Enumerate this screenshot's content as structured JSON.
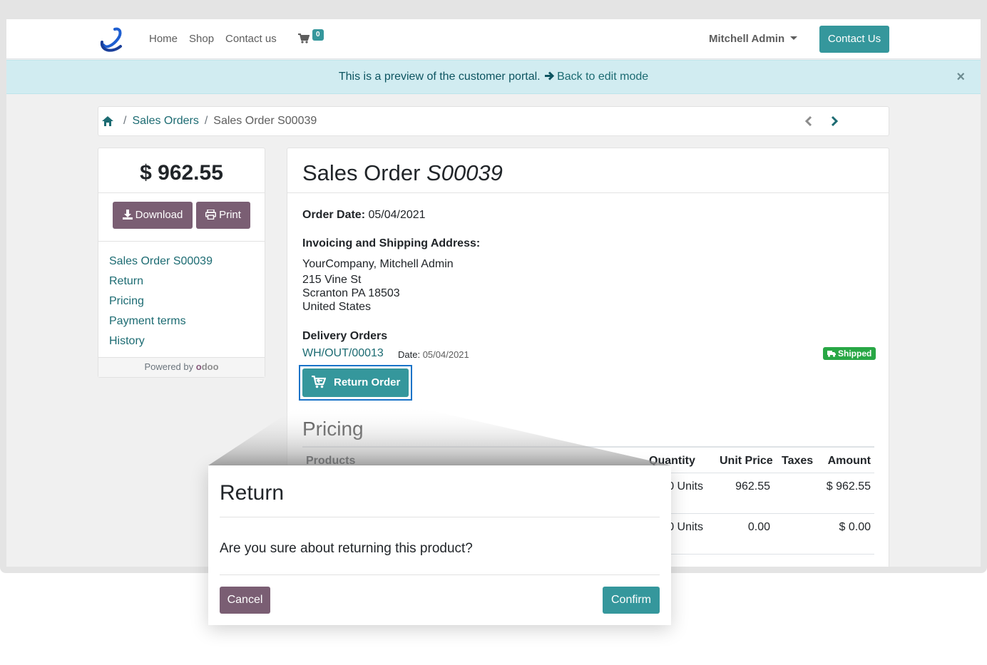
{
  "navbar": {
    "logo_icon": "company-logo-icon",
    "links": [
      "Home",
      "Shop",
      "Contact us"
    ],
    "cart_count": "0",
    "user_name": "Mitchell Admin",
    "contact_button": "Contact Us"
  },
  "alert": {
    "text": "This is a preview of the customer portal.",
    "link": "Back to edit mode",
    "close": "×"
  },
  "breadcrumb": {
    "items": [
      "Sales Orders",
      "Sales Order S00039"
    ],
    "prev": "‹",
    "next": "›"
  },
  "sidebar": {
    "total": "$ 962.55",
    "download_label": "Download",
    "print_label": "Print",
    "links": [
      "Sales Order S00039",
      "Return",
      "Pricing",
      "Payment terms",
      "History"
    ],
    "powered_by": "Powered by",
    "odoo_o": "o",
    "odoo_rest": "doo"
  },
  "order": {
    "title_prefix": "Sales Order",
    "title_number": "S00039",
    "order_date_label": "Order Date:",
    "order_date": "05/04/2021",
    "address_title": "Invoicing and Shipping Address:",
    "address_lines": [
      "YourCompany, Mitchell Admin",
      "215 Vine St",
      "Scranton PA 18503",
      "United States"
    ],
    "delivery_title": "Delivery Orders",
    "delivery_ref": "WH/OUT/00013",
    "delivery_date_label": "Date:",
    "delivery_date": "05/04/2021",
    "delivery_status": "Shipped",
    "return_button": "Return Order"
  },
  "pricing": {
    "title": "Pricing",
    "headers": {
      "products": "Products",
      "quantity": "Quantity",
      "unit_price": "Unit Price",
      "taxes": "Taxes",
      "amount": "Amount"
    },
    "rows": [
      {
        "quantity": "1.00 Units",
        "unit_price": "962.55",
        "taxes": "",
        "amount": "$ 962.55"
      },
      {
        "quantity": "1.00 Units",
        "unit_price": "0.00",
        "taxes": "",
        "amount": "$ 0.00"
      }
    ]
  },
  "modal": {
    "title": "Return",
    "body": "Are you sure about returning this product?",
    "cancel": "Cancel",
    "confirm": "Confirm"
  },
  "colors": {
    "primary": "#35979c",
    "secondary": "#7a5e73",
    "link": "#1c6b72",
    "success": "#28a745",
    "alert_bg": "#d1ecf1"
  }
}
